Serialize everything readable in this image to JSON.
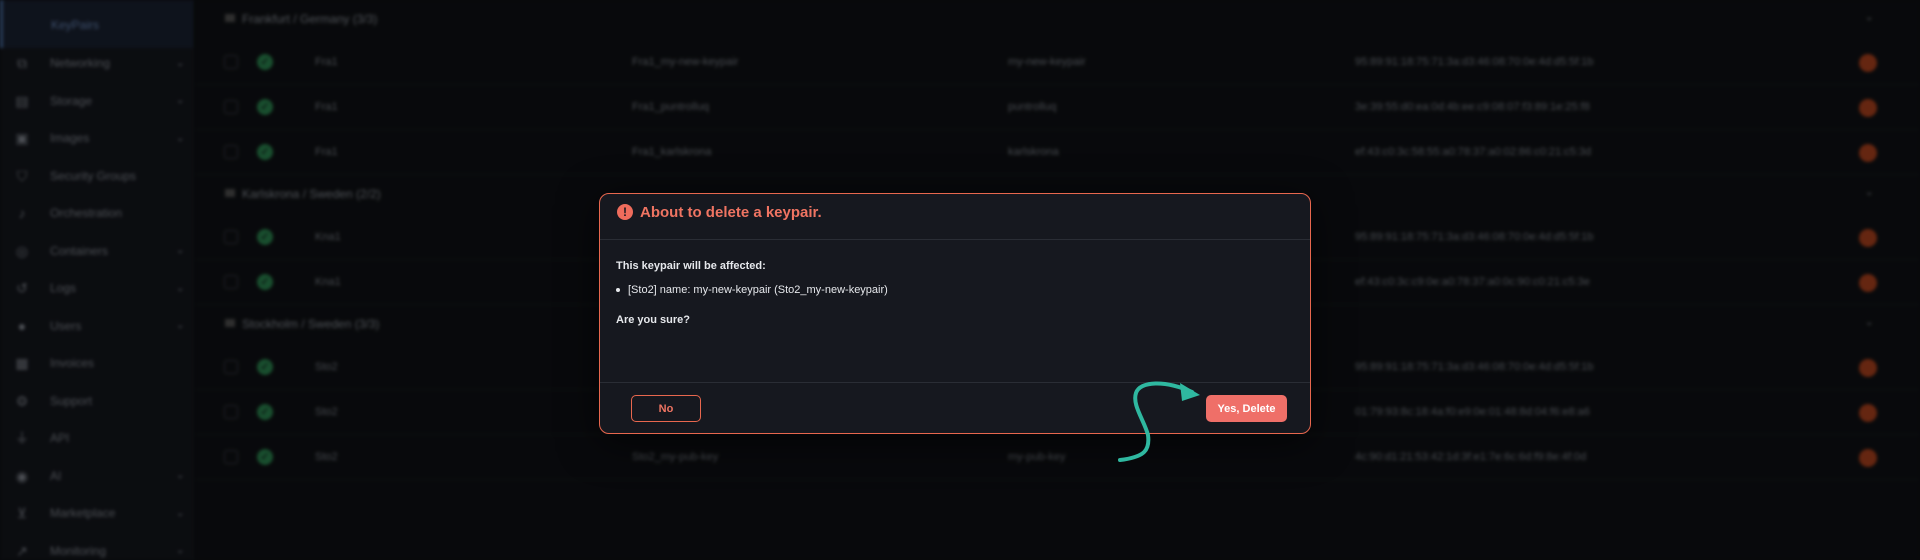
{
  "sidebar": {
    "active_label": "KeyPairs",
    "items": [
      {
        "label": "Networking",
        "icon": "network-icon",
        "chevron": true
      },
      {
        "label": "Storage",
        "icon": "storage-icon",
        "chevron": true
      },
      {
        "label": "Images",
        "icon": "image-icon",
        "chevron": true
      },
      {
        "label": "Security Groups",
        "icon": "shield-icon",
        "chevron": false
      },
      {
        "label": "Orchestration",
        "icon": "orchestration-icon",
        "chevron": false
      },
      {
        "label": "Containers",
        "icon": "container-icon",
        "chevron": true
      },
      {
        "label": "Logs",
        "icon": "logs-icon",
        "chevron": true
      },
      {
        "label": "Users",
        "icon": "user-icon",
        "chevron": true
      },
      {
        "label": "Invoices",
        "icon": "invoice-icon",
        "chevron": false
      },
      {
        "label": "Support",
        "icon": "support-icon",
        "chevron": false
      },
      {
        "label": "API",
        "icon": "plug-icon",
        "chevron": false
      },
      {
        "label": "AI",
        "icon": "ai-icon",
        "chevron": true
      },
      {
        "label": "Marketplace",
        "icon": "cart-icon",
        "chevron": true
      },
      {
        "label": "Monitoring",
        "icon": "chart-icon",
        "chevron": true
      }
    ]
  },
  "groups": [
    {
      "name": "Frankfurt / Germany (3/3)",
      "rows": [
        {
          "region": "Fra1",
          "full_name": "Fra1_my-new-keypair",
          "name": "my-new-keypair",
          "fingerprint": "95:89:91:18:75:71:3a:d3:46:08:70:0e:4d:d5:5f:1b"
        },
        {
          "region": "Fra1",
          "full_name": "Fra1_puntrolluq",
          "name": "puntrolluq",
          "fingerprint": "3e:39:55:d0:ea:0d:4b:ee:c9:08:07:f3:89:1e:25:f8"
        },
        {
          "region": "Fra1",
          "full_name": "Fra1_karlskrona",
          "name": "karlskrona",
          "fingerprint": "ef:43:c0:3c:58:55:a0:78:37:a0:02:86:c0:21:c5:3d"
        }
      ]
    },
    {
      "name": "Karlskrona / Sweden (2/2)",
      "rows": [
        {
          "region": "Kna1",
          "full_name": "",
          "name": "",
          "fingerprint": "95:89:91:18:75:71:3a:d3:46:08:70:0e:4d:d5:5f:1b"
        },
        {
          "region": "Kna1",
          "full_name": "",
          "name": "",
          "fingerprint": "ef:43:c0:3c:c9:0e:a0:78:37:a0:0c:90:c0:21:c5:3e"
        }
      ]
    },
    {
      "name": "Stockholm / Sweden (3/3)",
      "rows": [
        {
          "region": "Sto2",
          "full_name": "",
          "name": "",
          "fingerprint": "95:89:91:18:75:71:3a:d3:46:08:70:0e:4d:d5:5f:1b"
        },
        {
          "region": "Sto2",
          "full_name": "",
          "name": "",
          "fingerprint": "01:79:93:8c:18:4a:f0:e9:0e:01:48:8d:04:f6:e8:a6"
        },
        {
          "region": "Sto2",
          "full_name": "Sto2_my-pub-key",
          "name": "my-pub-key",
          "fingerprint": "4c:90:d1:21:53:42:1d:3f:e1:7e:6c:6d:f9:8e:4f:0d"
        }
      ]
    }
  ],
  "modal": {
    "title": "About to delete a keypair.",
    "affected_text": "This keypair will be affected:",
    "item_text": "[Sto2] name: my-new-keypair (Sto2_my-new-keypair)",
    "confirm_text": "Are you sure?",
    "no_label": "No",
    "yes_label": "Yes, Delete"
  },
  "colors": {
    "accent": "#ef6f68",
    "border": "#e8674e",
    "success": "#2e8f55",
    "arrow": "#2fb8a0"
  }
}
